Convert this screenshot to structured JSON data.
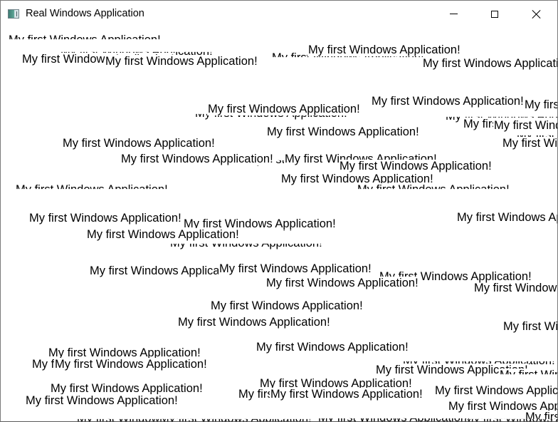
{
  "window": {
    "title": "Real Windows Application",
    "icon": "application-window-icon",
    "controls": {
      "minimize": "minimize-icon",
      "maximize": "maximize-icon",
      "close": "close-icon"
    }
  },
  "client": {
    "message": "My first Windows Application!",
    "instance_count": 62
  }
}
